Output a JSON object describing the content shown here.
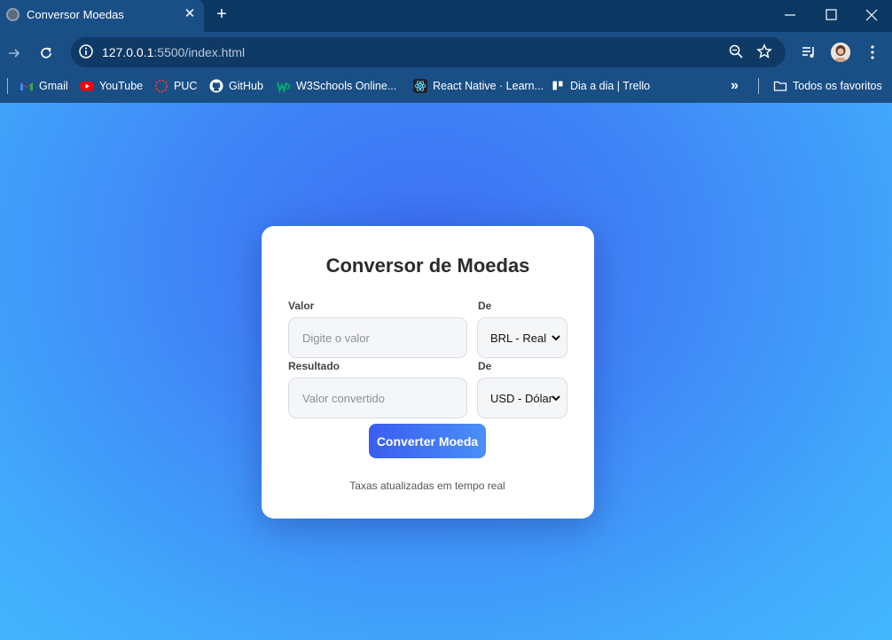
{
  "browser": {
    "tab": {
      "title": "Conversor Moedas",
      "close_glyph": "✕"
    },
    "new_tab_glyph": "+",
    "url": {
      "host": "127.0.0.1",
      "path": ":5500/index.html"
    },
    "bookmarks": [
      {
        "label": "Gmail",
        "icon": "gmail-icon"
      },
      {
        "label": "YouTube",
        "icon": "youtube-icon"
      },
      {
        "label": "PUC",
        "icon": "puc-icon"
      },
      {
        "label": "GitHub",
        "icon": "github-icon"
      },
      {
        "label": "W3Schools Online...",
        "icon": "w3schools-icon"
      },
      {
        "label": "React Native · Learn...",
        "icon": "react-icon"
      },
      {
        "label": "Dia a dia | Trello",
        "icon": "trello-icon"
      }
    ],
    "overflow_glyph": "»",
    "all_bookmarks_label": "Todos os favoritos"
  },
  "converter": {
    "title": "Conversor de Moedas",
    "value_label": "Valor",
    "value_placeholder": "Digite o valor",
    "from_label": "De",
    "from_selected": "BRL - Real",
    "result_label": "Resultado",
    "result_placeholder": "Valor convertido",
    "to_label": "De",
    "to_selected": "USD - Dólar",
    "convert_button": "Converter Moeda",
    "footer_note": "Taxas atualizadas em tempo real"
  },
  "colors": {
    "accent_start": "#3a5df0",
    "accent_end": "#4a8ff7",
    "page_bg": "#3f86f7"
  }
}
